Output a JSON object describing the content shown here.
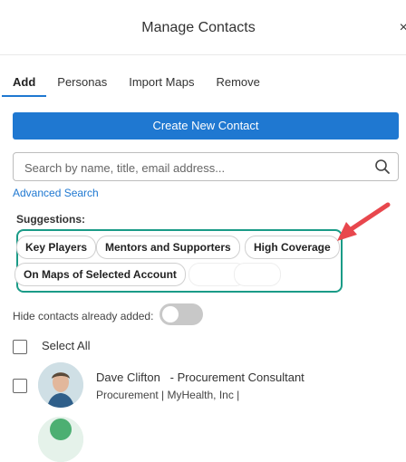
{
  "dialog": {
    "title": "Manage Contacts",
    "close_glyph": "×"
  },
  "tabs": [
    {
      "label": "Add",
      "active": true
    },
    {
      "label": "Personas",
      "active": false
    },
    {
      "label": "Import Maps",
      "active": false
    },
    {
      "label": "Remove",
      "active": false
    }
  ],
  "actions": {
    "create_label": "Create New Contact"
  },
  "search": {
    "placeholder": "Search by name, title, email address...",
    "value": "",
    "icon": "search-icon"
  },
  "advanced_search_label": "Advanced Search",
  "suggestions": {
    "label": "Suggestions:",
    "chips": [
      "Key Players",
      "Mentors and Supporters",
      "High Coverage",
      "On Maps of Selected Account"
    ]
  },
  "filters": {
    "hide_added_label": "Hide contacts already added:",
    "hide_added_on": false
  },
  "select_all_label": "Select All",
  "contacts": [
    {
      "name": "Dave Clifton",
      "title": "Procurement Consultant",
      "subtitle": "Procurement | MyHealth, Inc |"
    }
  ],
  "colors": {
    "primary": "#1f78d1",
    "highlight_box": "#1a9b87",
    "arrow": "#e8474d"
  }
}
